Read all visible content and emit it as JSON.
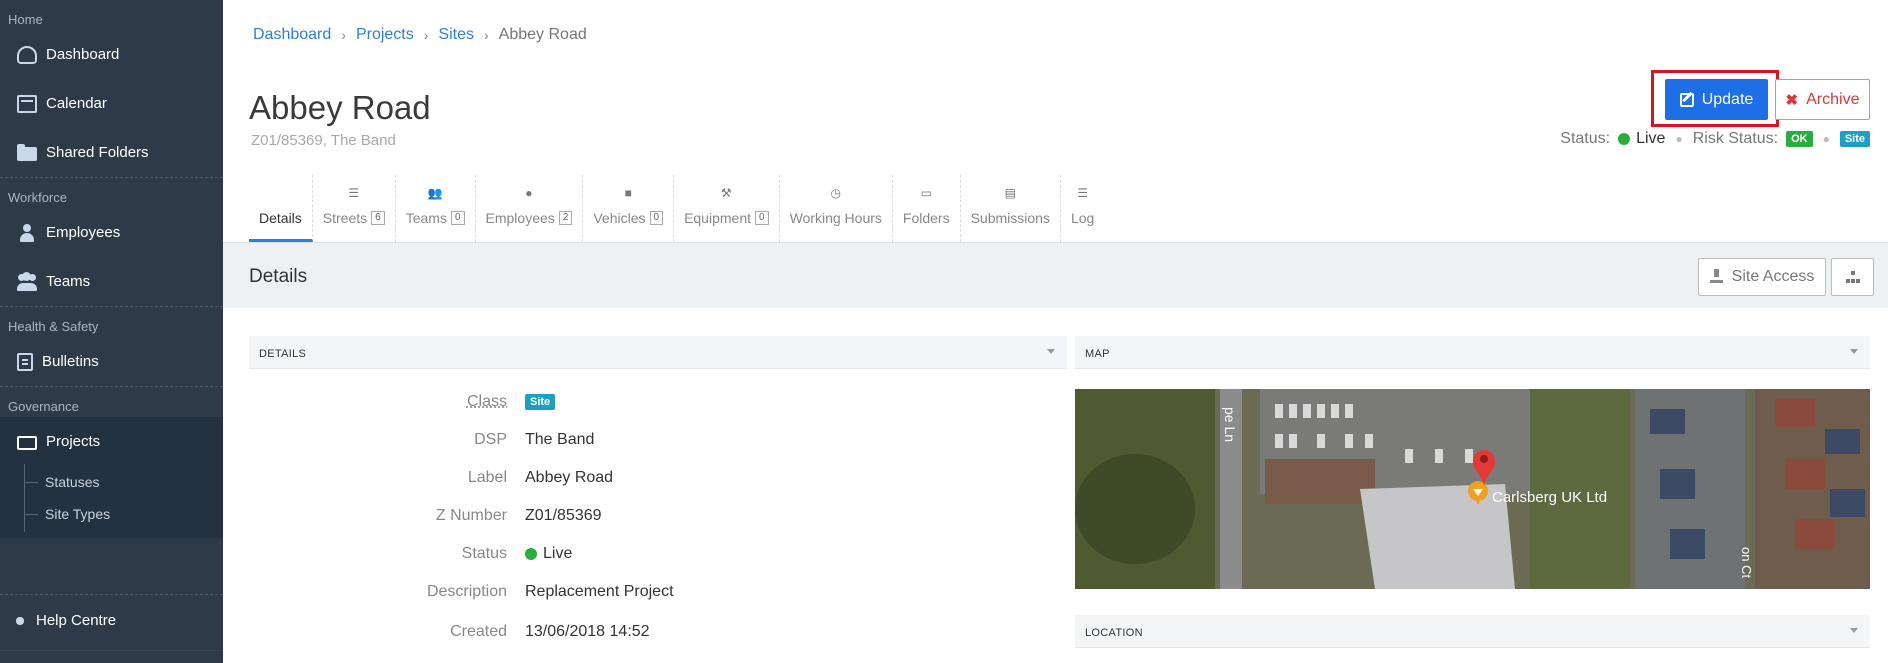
{
  "sidebar": {
    "sections": [
      {
        "label": "Home",
        "items": [
          "Dashboard",
          "Calendar",
          "Shared Folders"
        ]
      },
      {
        "label": "Workforce",
        "items": [
          "Employees",
          "Teams"
        ]
      },
      {
        "label": "Health & Safety",
        "items": [
          "Bulletins"
        ]
      },
      {
        "label": "Governance",
        "items": [
          "Projects"
        ]
      }
    ],
    "subitems": [
      "Statuses",
      "Site Types"
    ],
    "help": "Help Centre"
  },
  "breadcrumb": [
    "Dashboard",
    "Projects",
    "Sites",
    "Abbey Road"
  ],
  "page": {
    "title": "Abbey Road",
    "subtitle": "Z01/85369, The Band",
    "update_label": "Update",
    "archive_label": "Archive",
    "status_label": "Status:",
    "status_value": "Live",
    "risk_label": "Risk Status:",
    "risk_badge": "OK",
    "site_badge": "Site"
  },
  "tabs": [
    {
      "label": "Details",
      "count": null,
      "icon": "info"
    },
    {
      "label": "Streets",
      "count": "6",
      "icon": "list"
    },
    {
      "label": "Teams",
      "count": "0",
      "icon": "users"
    },
    {
      "label": "Employees",
      "count": "2",
      "icon": "user"
    },
    {
      "label": "Vehicles",
      "count": "0",
      "icon": "truck"
    },
    {
      "label": "Equipment",
      "count": "0",
      "icon": "wrench"
    },
    {
      "label": "Working Hours",
      "count": null,
      "icon": "clock"
    },
    {
      "label": "Folders",
      "count": null,
      "icon": "folder"
    },
    {
      "label": "Submissions",
      "count": null,
      "icon": "file"
    },
    {
      "label": "Log",
      "count": null,
      "icon": "list"
    }
  ],
  "details_bar": {
    "title": "Details",
    "site_access_label": "Site Access"
  },
  "details_panel": {
    "header": "DETAILS",
    "fields": [
      {
        "label": "Class",
        "value": "Site"
      },
      {
        "label": "DSP",
        "value": "The Band"
      },
      {
        "label": "Label",
        "value": "Abbey Road"
      },
      {
        "label": "Z Number",
        "value": "Z01/85369"
      },
      {
        "label": "Status",
        "value": "Live"
      },
      {
        "label": "Description",
        "value": "Replacement Project"
      },
      {
        "label": "Created",
        "value": "13/06/2018 14:52"
      }
    ]
  },
  "map_panel": {
    "header": "MAP",
    "place_label": "Carlsberg UK Ltd",
    "road_label_1": "pe Ln",
    "road_label_2": "on Ct"
  },
  "location_panel": {
    "header": "LOCATION"
  },
  "colors": {
    "sidebar_bg": "#2e3a48",
    "primary": "#1e6fe6",
    "danger": "#d63a3a",
    "success": "#27ae3d",
    "info": "#1ba0c4"
  }
}
